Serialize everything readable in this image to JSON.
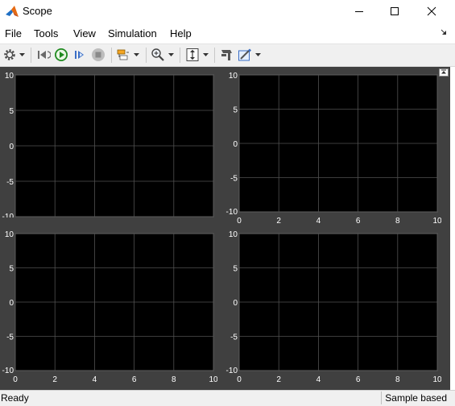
{
  "window": {
    "title": "Scope",
    "controls": [
      "minimize",
      "maximize",
      "close"
    ]
  },
  "menu": [
    "File",
    "Tools",
    "View",
    "Simulation",
    "Help"
  ],
  "toolbar": [
    "gear-icon",
    "dropdown-arrow-icon",
    "step-back-icon",
    "run-icon",
    "step-forward-icon",
    "stop-icon",
    "highlight-block-icon",
    "dropdown-arrow-icon",
    "zoom-in-icon",
    "dropdown-arrow-icon",
    "autoscale-icon",
    "dropdown-arrow-icon",
    "signal-selector-icon",
    "style-icon",
    "dropdown-arrow-icon"
  ],
  "theme": {
    "axes_bg": "#000000",
    "figure_bg": "#404040",
    "grid": "#505050",
    "tick_text": "#ffffff"
  },
  "chart_data": [
    {
      "type": "line",
      "series": [],
      "xlim": [
        0,
        10
      ],
      "ylim": [
        -10,
        10
      ],
      "x_ticks": [],
      "y_ticks": [
        "10",
        "5",
        "0",
        "-5",
        "-10"
      ],
      "grid": true
    },
    {
      "type": "line",
      "series": [],
      "xlim": [
        0,
        10
      ],
      "ylim": [
        -10,
        10
      ],
      "x_ticks": [
        "0",
        "2",
        "4",
        "6",
        "8",
        "10"
      ],
      "y_ticks": [
        "10",
        "5",
        "0",
        "-5",
        "-10"
      ],
      "grid": true
    },
    {
      "type": "line",
      "series": [],
      "xlim": [
        0,
        10
      ],
      "ylim": [
        -10,
        10
      ],
      "x_ticks": [
        "0",
        "2",
        "4",
        "6",
        "8",
        "10"
      ],
      "y_ticks": [
        "10",
        "5",
        "0",
        "-5",
        "-10"
      ],
      "grid": true
    },
    {
      "type": "line",
      "series": [],
      "xlim": [
        0,
        10
      ],
      "ylim": [
        -10,
        10
      ],
      "x_ticks": [
        "0",
        "2",
        "4",
        "6",
        "8",
        "10"
      ],
      "y_ticks": [
        "10",
        "5",
        "0",
        "-5",
        "-10"
      ],
      "grid": true
    }
  ],
  "status": {
    "text": "Ready",
    "mode": "Sample based"
  }
}
